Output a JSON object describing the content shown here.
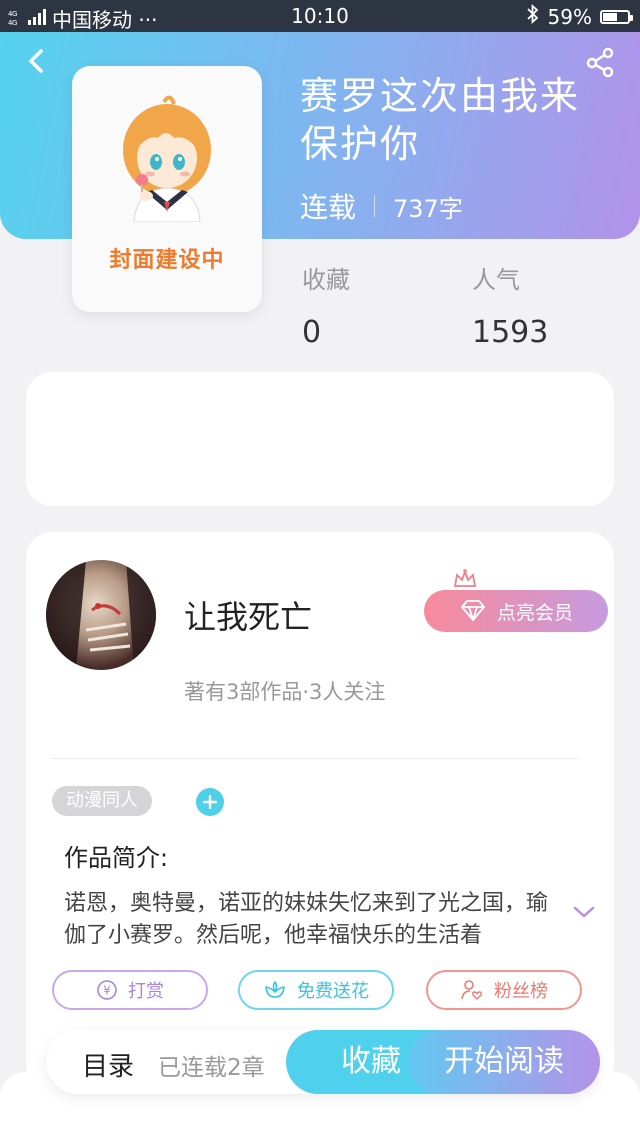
{
  "status_bar": {
    "signal": "4G 4G",
    "carrier": "中国移动 ···",
    "time": "10:10",
    "battery_percent": "59%",
    "battery_level": 0.59
  },
  "header": {
    "title": "赛罗这次由我来保护你",
    "status": "连载",
    "word_count": "737字",
    "cover_text": "封面建设中",
    "back_icon": "chevron-left-icon",
    "share_icon": "share-icon"
  },
  "stats": {
    "favorites_label": "收藏",
    "favorites_value": "0",
    "popularity_label": "人气",
    "popularity_value": "1593"
  },
  "author": {
    "name": "让我死亡",
    "info": "著有3部作品·3人关注",
    "vip_label": "点亮会员"
  },
  "work": {
    "tag": "动漫同人",
    "intro_label": "作品简介:",
    "intro_text": "诺恩，奥特曼，诺亚的妹妹失忆来到了光之国，瑜伽了小赛罗。然后呢，他幸福快乐的生活着"
  },
  "actions": {
    "tip": "打赏",
    "flower": "免费送花",
    "fans": "粉丝榜"
  },
  "bottom_bar": {
    "toc": "目录",
    "chapters": "已连载2章",
    "favorite": "收藏",
    "read": "开始阅读"
  },
  "colors": {
    "gradient_start": "#55d3ee",
    "gradient_end": "#b293ea",
    "accent_cyan": "#4fd0ec",
    "cover_text": "#f07a2a"
  }
}
